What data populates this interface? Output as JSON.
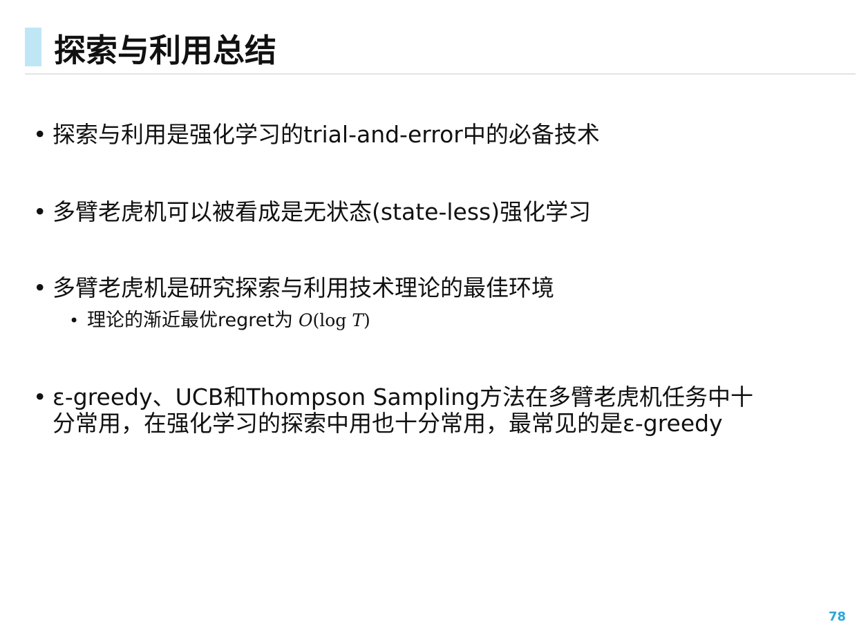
{
  "slide": {
    "title": "探索与利用总结",
    "page_number": "78"
  },
  "bullets": [
    {
      "marker": "•",
      "text": "探索与利用是强化学习的trial-and-error中的必备技术"
    },
    {
      "marker": "•",
      "text": "多臂老虎机可以被看成是无状态(state-less)强化学习"
    },
    {
      "marker": "•",
      "text": "多臂老虎机是研究探索与利用技术理论的最佳环境"
    },
    {
      "marker": "•",
      "text_line1": "ε-greedy、UCB和Thompson Sampling方法在多臂老虎机任务中十",
      "text_line2": "分常用，在强化学习的探索中用也十分常用，最常见的是ε-greedy"
    }
  ],
  "sub_bullet": {
    "marker": "•",
    "text": "理论的渐近最优regret为",
    "math_O": "O",
    "math_open": "(",
    "math_log": "log",
    "math_T": "T",
    "math_close": ")"
  },
  "colors": {
    "accent": "#bfe6f5",
    "page_number": "#2aa6d9",
    "rule": "#e2e2e2"
  }
}
